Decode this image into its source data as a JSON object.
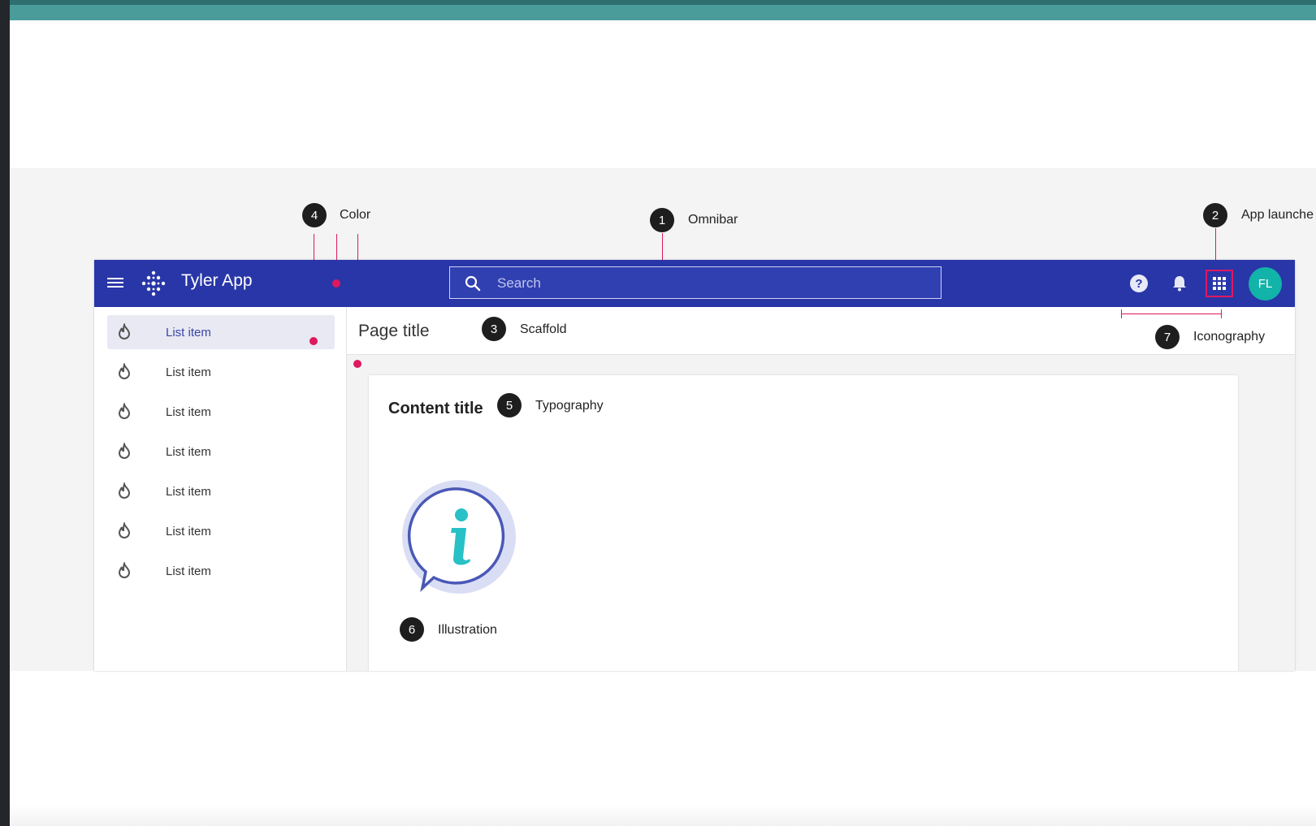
{
  "callouts": {
    "omnibar": {
      "number": "1",
      "label": "Omnibar"
    },
    "app_launcher": {
      "number": "2",
      "label": "App launche"
    },
    "scaffold": {
      "number": "3",
      "label": "Scaffold"
    },
    "color": {
      "number": "4",
      "label": "Color"
    },
    "typography": {
      "number": "5",
      "label": "Typography"
    },
    "illustration": {
      "number": "6",
      "label": "Illustration"
    },
    "iconography": {
      "number": "7",
      "label": "Iconography"
    }
  },
  "omnibar": {
    "app_title": "Tyler App",
    "search_placeholder": "Search",
    "avatar_initials": "FL",
    "icons": [
      "menu-icon",
      "logo-icon",
      "search-icon",
      "help-icon",
      "bell-icon",
      "apps-grid-icon"
    ]
  },
  "sidebar": {
    "items": [
      {
        "label": "List item",
        "icon": "flame-icon",
        "selected": true
      },
      {
        "label": "List item",
        "icon": "flame-icon",
        "selected": false
      },
      {
        "label": "List item",
        "icon": "flame-icon",
        "selected": false
      },
      {
        "label": "List item",
        "icon": "flame-icon",
        "selected": false
      },
      {
        "label": "List item",
        "icon": "flame-icon",
        "selected": false
      },
      {
        "label": "List item",
        "icon": "flame-icon",
        "selected": false
      },
      {
        "label": "List item",
        "icon": "flame-icon",
        "selected": false
      }
    ]
  },
  "page": {
    "title": "Page title",
    "content_title": "Content title",
    "illustration_icon": "info-bubble-icon"
  },
  "colors": {
    "omnibar": "#2836a8",
    "accent": "#e0185f",
    "avatar": "#12b3a8",
    "top_strip": "#4a9c9b"
  }
}
